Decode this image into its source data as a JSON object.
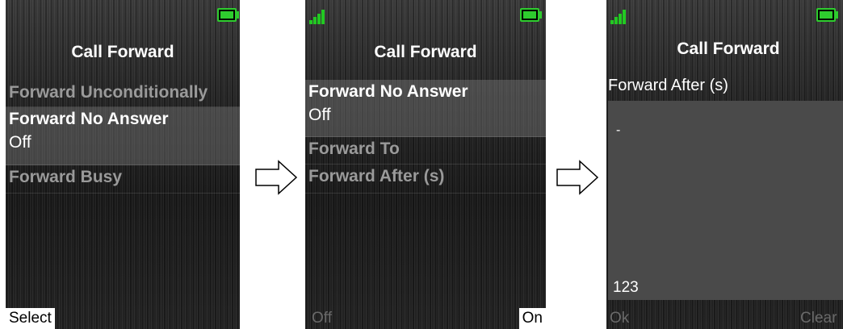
{
  "colors": {
    "battery": "#2ecc2e",
    "signal": "#22c922",
    "selected_row": "#6a6a6a",
    "edit_box": "#4a4a4a"
  },
  "screens": [
    {
      "title": "Call Forward",
      "items": [
        {
          "label": "Forward Unconditionally"
        },
        {
          "label": "Forward No Answer",
          "value": "Off",
          "selected": true
        },
        {
          "label": "Forward Busy"
        }
      ],
      "softkeys": {
        "left": "Select"
      }
    },
    {
      "title": "Call Forward",
      "items": [
        {
          "label": "Forward No Answer",
          "value": "Off",
          "selected": true
        },
        {
          "label": "Forward To"
        },
        {
          "label": "Forward After (s)"
        }
      ],
      "softkeys": {
        "left": "Off",
        "right": "On"
      }
    },
    {
      "title": "Call Forward",
      "field_label": "Forward After (s)",
      "field_value": "-",
      "input_mode": "123",
      "softkeys": {
        "left": "Ok",
        "right": "Clear"
      }
    }
  ],
  "icons": [
    "battery-icon",
    "signal-strength-icon",
    "right-arrow-icon"
  ]
}
